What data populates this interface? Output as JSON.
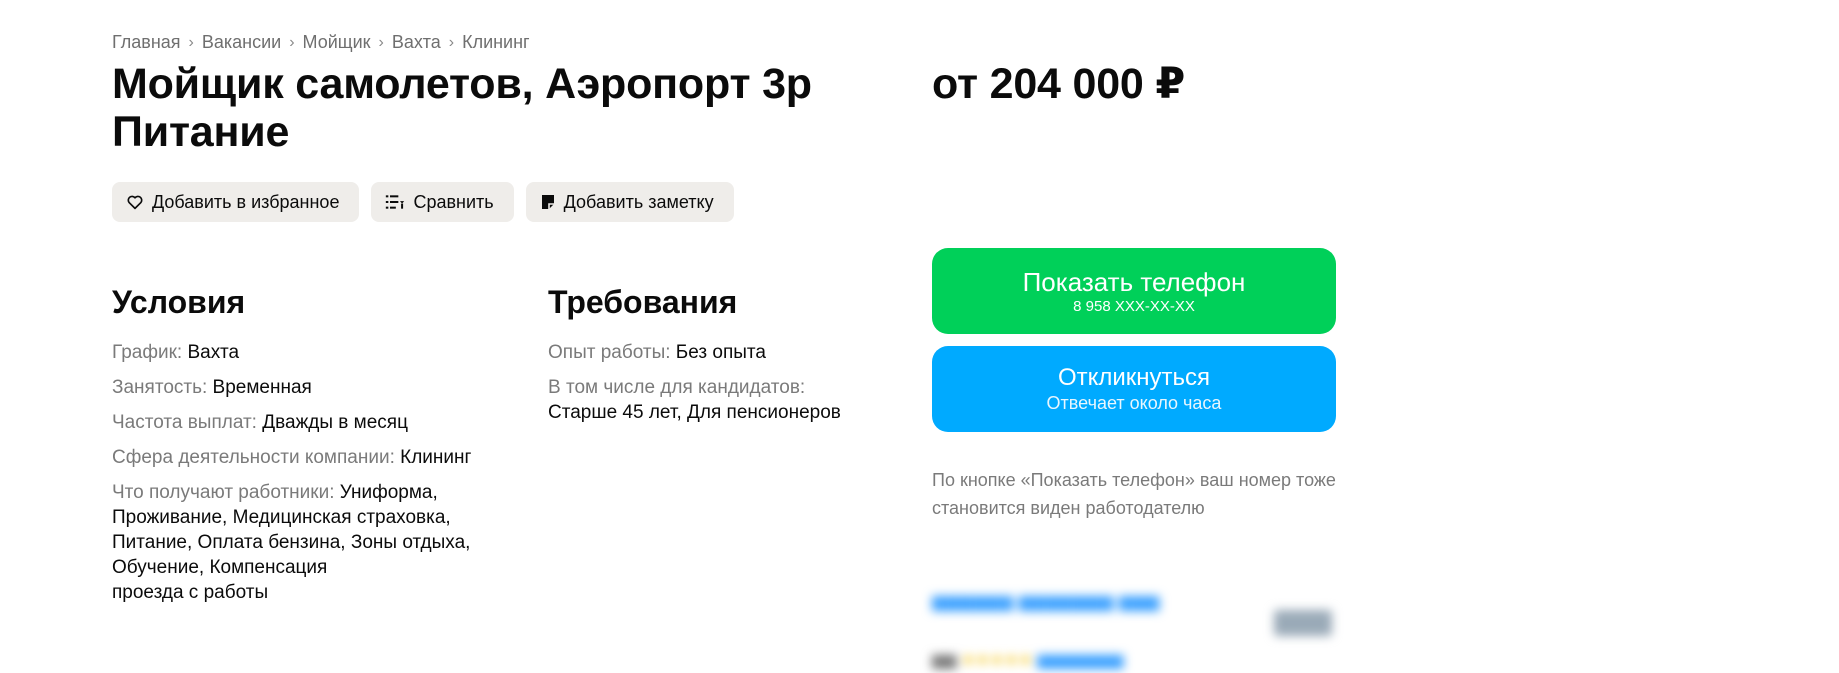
{
  "breadcrumb": [
    "Главная",
    "Вакансии",
    "Мойщик",
    "Вахта",
    "Клининг"
  ],
  "breadcrumb_separator": "›",
  "vacancy": {
    "title_line1": "Мойщик самолетов, Аэропорт 3р",
    "title_line2": "Питание",
    "salary": "от 204 000 ₽"
  },
  "actions": {
    "favorite": "Добавить в избранное",
    "compare": "Сравнить",
    "note": "Добавить заметку"
  },
  "conditions": {
    "title": "Условия",
    "schedule_label": "График:",
    "schedule_value": "Вахта",
    "employment_label": "Занятость:",
    "employment_value": "Временная",
    "pay_label": "Частота выплат:",
    "pay_value": "Дважды в месяц",
    "sphere_label": "Сфера деятельности компании:",
    "sphere_value": "Клининг",
    "benefits_label": "Что получают работники:",
    "benefits_value": "Униформа, Проживание, Медицинская страховка, Питание, Оплата бензина, Зоны отдыха, Обучение, Компенсация",
    "benefits_value_tail": "проезда с работы"
  },
  "requirements": {
    "title": "Требования",
    "experience_label": "Опыт работы:",
    "experience_value": "Без опыта",
    "candidates_label": "В том числе для кандидатов:",
    "candidates_value": "Старше 45 лет, Для пенсионеров"
  },
  "contact": {
    "phone_button": "Показать телефон",
    "phone_masked": "8 958 XXX-XX-XX",
    "respond_button": "Откликнуться",
    "respond_sub": "Отвечает около часа",
    "note": "По кнопке «Показать телефон» ваш номер тоже становится виден работодателю"
  },
  "colors": {
    "phone_button": "#00d059",
    "respond_button": "#00aaff",
    "chip_background": "#efedea"
  }
}
